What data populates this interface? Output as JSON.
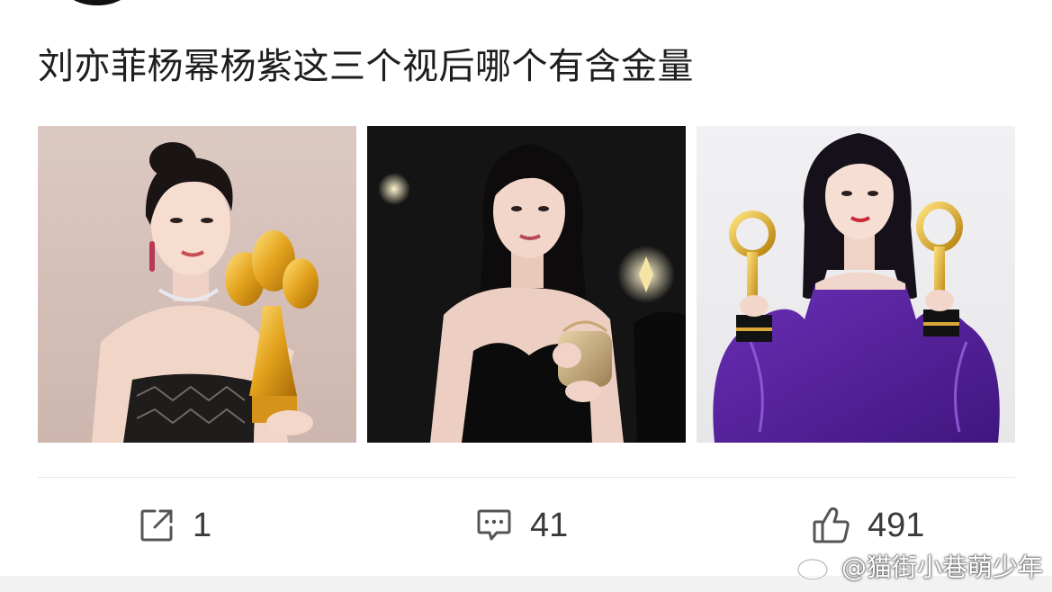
{
  "post": {
    "title": "刘亦菲杨幂杨紫这三个视后哪个有含金量"
  },
  "images": [
    {
      "name": "photo-woman-strapless-gold-trophy",
      "background": "#d8c6c0"
    },
    {
      "name": "photo-woman-black-dress-dark-stage",
      "background": "#141414"
    },
    {
      "name": "photo-woman-purple-dress-two-trophies",
      "background": "#eeeef0"
    }
  ],
  "actions": {
    "repost": {
      "icon": "repost-icon",
      "count": "1"
    },
    "comment": {
      "icon": "comment-icon",
      "count": "41"
    },
    "like": {
      "icon": "thumbs-up-icon",
      "count": "491"
    }
  },
  "watermark": {
    "text": "@猫街小巷萌少年",
    "logo": "weibo-logo-icon"
  },
  "colors": {
    "text": "#1e1e1e",
    "counts": "#3a3a3a",
    "icons": "#555555",
    "divider": "#e6e6e6"
  }
}
